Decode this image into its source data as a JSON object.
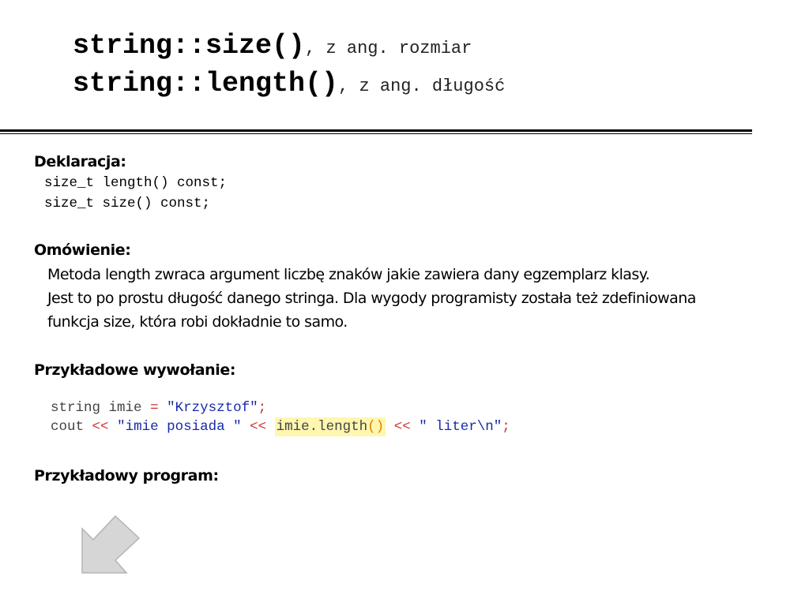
{
  "title": {
    "line1_main": "string::size()",
    "line1_sub": ", z ang. rozmiar",
    "line2_main": "string::length()",
    "line2_sub": ", z ang. długość"
  },
  "declaration": {
    "heading": "Deklaracja:",
    "lines": [
      "size_t length() const;",
      "size_t size() const;"
    ]
  },
  "discussion": {
    "heading": "Omówienie:",
    "lines": [
      "Metoda length zwraca argument liczbę znaków jakie zawiera dany egzemplarz klasy.",
      "Jest to po prostu długość danego stringa. Dla wygody programisty została też zdefiniowana",
      "funkcja size, która robi dokładnie to samo."
    ]
  },
  "example_call": {
    "heading": "Przykładowe wywołanie:",
    "line1": {
      "type": "string",
      "var": "imie",
      "assign": "=",
      "literal": "\"Krzysztof\"",
      "end": ";"
    },
    "line2": {
      "stream": "cout",
      "op": "<<",
      "literal1": "\"imie posiada \"",
      "call_obj": "imie.length",
      "call_parens": "()",
      "literal2": "\" liter\\n\"",
      "end": ";"
    }
  },
  "example_program": {
    "heading": "Przykładowy program:"
  },
  "icons": {
    "arrow": "arrow-down-left-icon"
  },
  "colors": {
    "highlight": "#fff6b0",
    "operator": "#cc3333",
    "string_literal": "#1a2aa8",
    "arrow_fill": "#d6d6d6"
  }
}
